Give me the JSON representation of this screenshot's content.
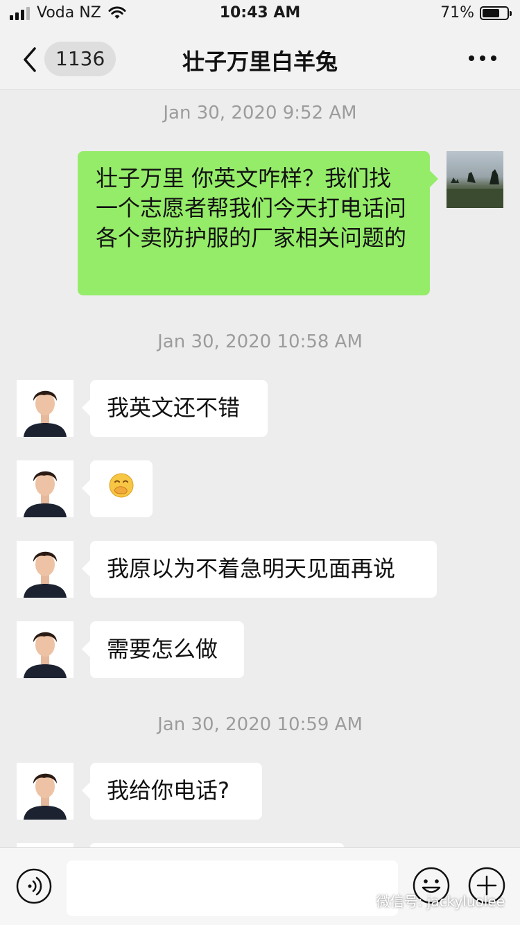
{
  "status_bar": {
    "carrier": "Voda NZ",
    "time": "10:43 AM",
    "battery_percent": "71%",
    "battery_level": 0.71
  },
  "nav": {
    "unread_count": "1136",
    "title": "壮子万里白羊兔"
  },
  "messages": {
    "ts1": "Jan 30, 2020 9:52 AM",
    "m1": "壮子万里 你英文咋样？我们找一个志愿者帮我们今天打电话问各个卖防护服的厂家相关问题的",
    "ts2": "Jan 30, 2020 10:58 AM",
    "m2": "我英文还不错",
    "m3": "🤭",
    "m4": "我原以为不着急明天见面再说",
    "m5": "需要怎么做",
    "ts3": "Jan 30, 2020 10:59 AM",
    "m6": "我给你电话?"
  },
  "input": {
    "placeholder": ""
  },
  "watermark": {
    "text": "微信号: jackyluolee"
  },
  "colors": {
    "outgoing_bubble": "#95ec69",
    "incoming_bubble": "#ffffff",
    "background": "#ededed"
  },
  "icons": [
    "back-chevron-icon",
    "more-dots-icon",
    "voice-icon",
    "emoji-icon",
    "plus-icon",
    "wechat-logo-icon"
  ]
}
